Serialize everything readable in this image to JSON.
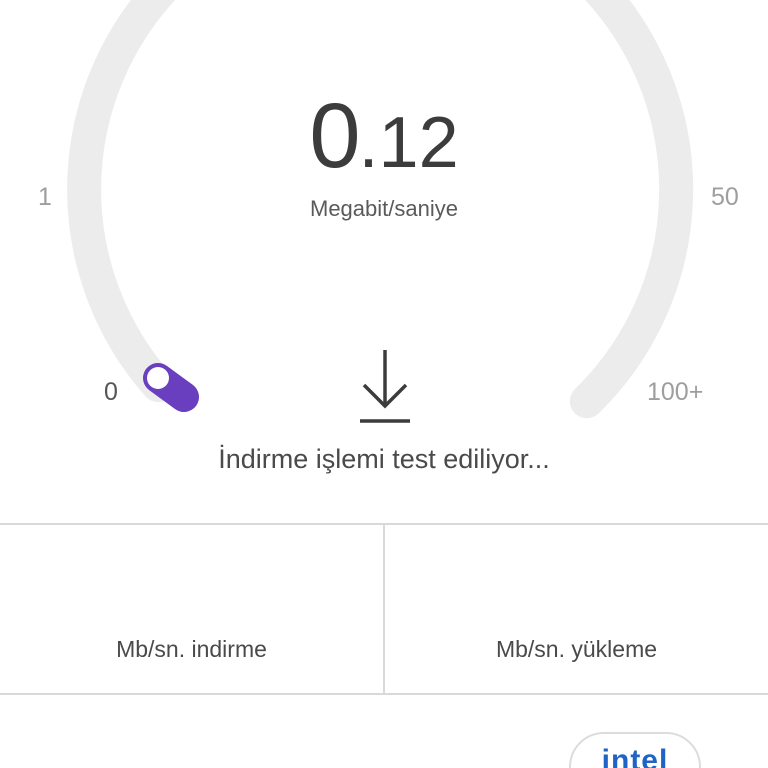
{
  "gauge": {
    "value_int": "0",
    "value_dec": ".12",
    "unit": "Megabit/saniye",
    "ticks": {
      "t1": "1",
      "t50": "50",
      "t0": "0",
      "t100": "100+"
    }
  },
  "status": "İndirme işlemi test ediliyor...",
  "results": {
    "download_label": "Mb/sn. indirme",
    "upload_label": "Mb/sn. yükleme"
  },
  "sponsor": {
    "logo_text": "intel"
  },
  "icons": {
    "download": "download-arrow-icon",
    "needle": "gauge-needle-icon"
  },
  "colors": {
    "accent": "#6a3fbf",
    "track": "#ececec",
    "brand": "#1f63c6"
  }
}
